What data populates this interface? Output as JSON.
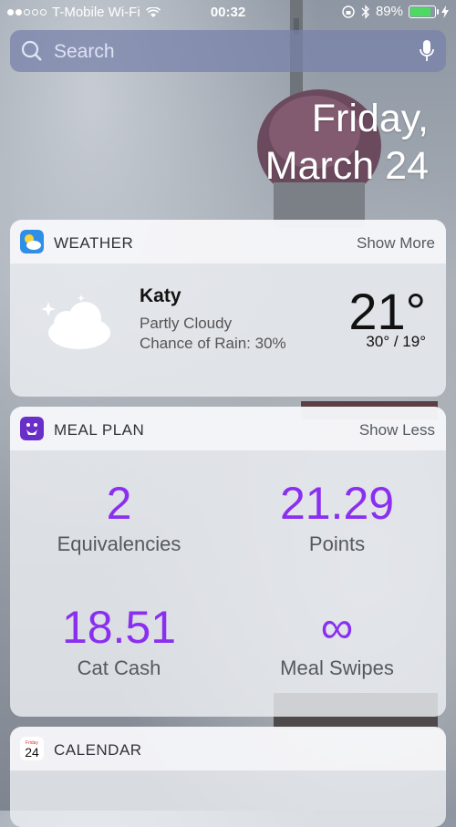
{
  "status_bar": {
    "carrier": "T-Mobile Wi-Fi",
    "time": "00:32",
    "battery": "89%",
    "battery_level": 0.89
  },
  "search": {
    "placeholder": "Search"
  },
  "date": {
    "weekday": "Friday,",
    "day": "March 24"
  },
  "weather": {
    "title": "WEATHER",
    "action": "Show More",
    "city": "Katy",
    "condition": "Partly Cloudy",
    "rain": "Chance of Rain: 30%",
    "temp": "21°",
    "range": "30° / 19°",
    "icon": "partly-cloudy-night-icon"
  },
  "meal_plan": {
    "title": "MEAL PLAN",
    "action": "Show Less",
    "accent": "#8a2ff0",
    "stats": [
      {
        "value": "2",
        "label": "Equivalencies"
      },
      {
        "value": "21.29",
        "label": "Points"
      },
      {
        "value": "18.51",
        "label": "Cat Cash"
      },
      {
        "value": "∞",
        "label": "Meal Swipes"
      }
    ]
  },
  "calendar": {
    "title": "CALENDAR",
    "icon_day": "24",
    "icon_weekday": "Friday"
  }
}
